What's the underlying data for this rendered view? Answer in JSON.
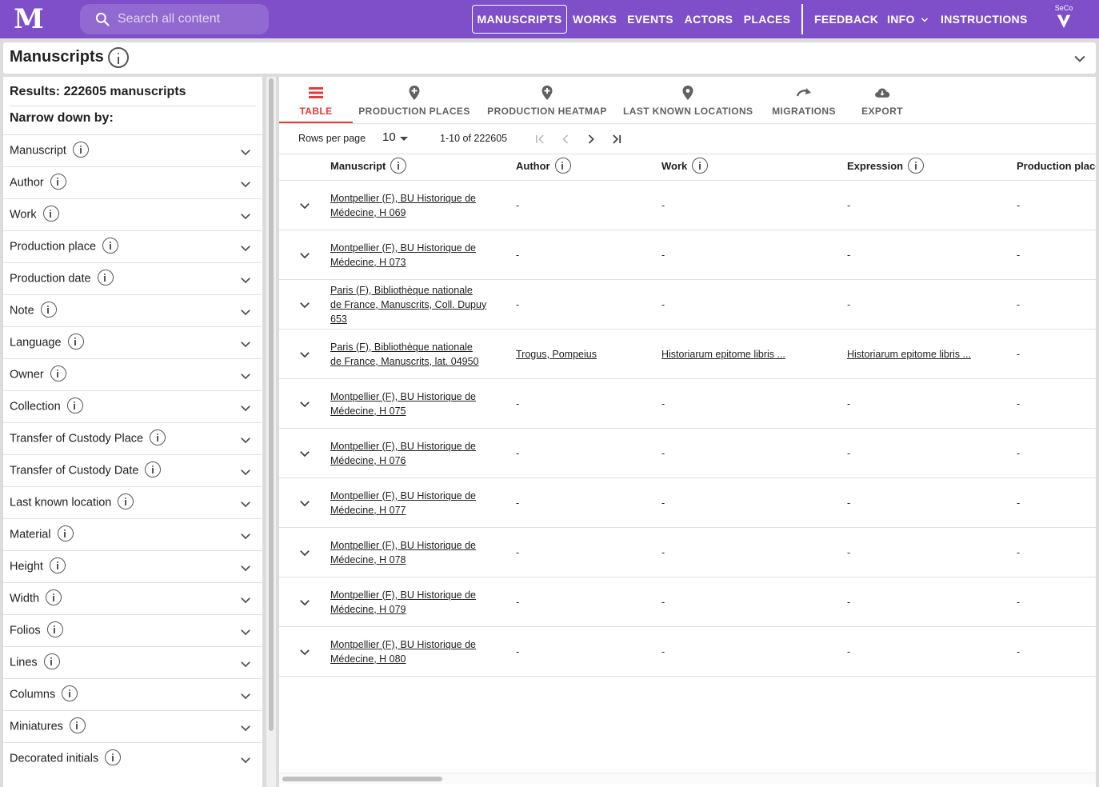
{
  "appbar": {
    "logo": "M",
    "search_placeholder": "Search all content",
    "nav": [
      "MANUSCRIPTS",
      "WORKS",
      "EVENTS",
      "ACTORS",
      "PLACES"
    ],
    "nav_right": [
      "FEEDBACK",
      "INFO",
      "INSTRUCTIONS"
    ],
    "seco": "SeCo"
  },
  "header": {
    "title": "Manuscripts"
  },
  "sidebar": {
    "results": "Results: 222605 manuscripts",
    "narrow": "Narrow down by:",
    "facets": [
      "Manuscript",
      "Author",
      "Work",
      "Production place",
      "Production date",
      "Note",
      "Language",
      "Owner",
      "Collection",
      "Transfer of Custody Place",
      "Transfer of Custody Date",
      "Last known location",
      "Material",
      "Height",
      "Width",
      "Folios",
      "Lines",
      "Columns",
      "Miniatures",
      "Decorated initials"
    ]
  },
  "tabs": [
    "TABLE",
    "PRODUCTION PLACES",
    "PRODUCTION HEATMAP",
    "LAST KNOWN LOCATIONS",
    "MIGRATIONS",
    "EXPORT"
  ],
  "pager": {
    "rows_per_page_label": "Rows per page",
    "rows_per_page": "10",
    "range": "1-10 of 222605"
  },
  "table": {
    "columns": [
      "Manuscript",
      "Author",
      "Work",
      "Expression",
      "Production place"
    ],
    "rows": [
      {
        "ms": [
          "Montpellier (F), BU Historique de",
          "Médecine, H 069"
        ],
        "author": "-",
        "work": "-",
        "expression": "-",
        "place": "-"
      },
      {
        "ms": [
          "Montpellier (F), BU Historique de",
          "Médecine, H 073"
        ],
        "author": "-",
        "work": "-",
        "expression": "-",
        "place": "-"
      },
      {
        "ms": [
          "Paris (F), Bibliothèque nationale",
          "de France, Manuscrits, Coll. Dupuy",
          "653"
        ],
        "author": "-",
        "work": "-",
        "expression": "-",
        "place": "-"
      },
      {
        "ms": [
          "Paris (F), Bibliothèque nationale",
          "de France, Manuscrits, lat. 04950"
        ],
        "author": "Trogus, Pompeius",
        "work": "Historiarum epitome libris ...",
        "expression": "Historiarum epitome libris ...",
        "place": "-"
      },
      {
        "ms": [
          "Montpellier (F), BU Historique de",
          "Médecine, H 075"
        ],
        "author": "-",
        "work": "-",
        "expression": "-",
        "place": "-"
      },
      {
        "ms": [
          "Montpellier (F), BU Historique de",
          "Médecine, H 076"
        ],
        "author": "-",
        "work": "-",
        "expression": "-",
        "place": "-"
      },
      {
        "ms": [
          "Montpellier (F), BU Historique de",
          "Médecine, H 077"
        ],
        "author": "-",
        "work": "-",
        "expression": "-",
        "place": "-"
      },
      {
        "ms": [
          "Montpellier (F), BU Historique de",
          "Médecine, H 078"
        ],
        "author": "-",
        "work": "-",
        "expression": "-",
        "place": "-"
      },
      {
        "ms": [
          "Montpellier (F), BU Historique de",
          "Médecine, H 079"
        ],
        "author": "-",
        "work": "-",
        "expression": "-",
        "place": "-"
      },
      {
        "ms": [
          "Montpellier (F), BU Historique de",
          "Médecine, H 080"
        ],
        "author": "-",
        "work": "-",
        "expression": "-",
        "place": "-"
      }
    ]
  },
  "colors": {
    "appbar": "#7e4fc9",
    "active_tab": "#e23b3b"
  }
}
